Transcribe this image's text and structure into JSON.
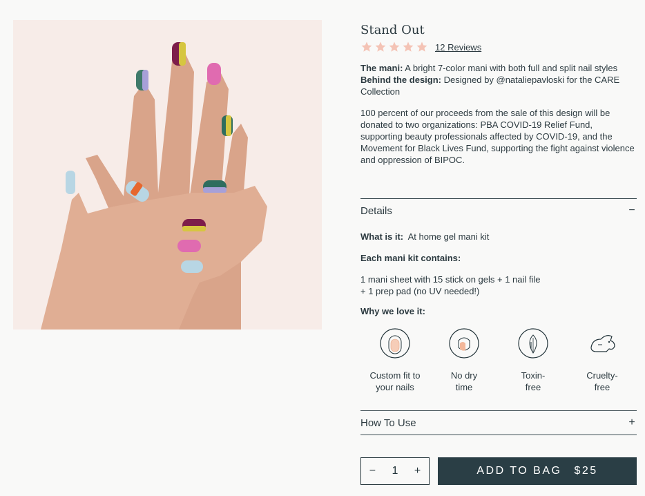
{
  "product": {
    "title": "Stand Out",
    "rating": 5,
    "reviews_label": "12 Reviews",
    "mani_label": "The mani:",
    "mani_text": " A bright 7-color mani with both full and split nail styles",
    "design_label": "Behind the design:",
    "design_text": " Designed by @nataliepavloski for the CARE Collection",
    "proceeds_text": "100 percent of our proceeds from the sale of this design will be donated to two organizations: PBA COVID-19 Relief Fund, supporting beauty professionals affected by COVID-19, and the Movement for Black Lives Fund, supporting the fight against violence and oppression of BIPOC."
  },
  "colors": {
    "star": "#f4c3b5",
    "button": "#2a3e45",
    "background": "#f9f9f8"
  },
  "details": {
    "title": "Details",
    "toggle": "−",
    "what_label": "What is it:",
    "what_text": "  At home gel mani kit",
    "contains_label": "Each mani kit contains:",
    "contains_line1": "1 mani sheet with 15 stick on gels + 1 nail file",
    "contains_line2": "+ 1 prep pad (no UV needed!)",
    "why_label": "Why we love it:",
    "features": [
      {
        "icon": "custom-fit-icon",
        "line1": "Custom fit to",
        "line2": "your nails"
      },
      {
        "icon": "no-dry-time-icon",
        "line1": "No dry",
        "line2": "time"
      },
      {
        "icon": "toxin-free-icon",
        "line1": "Toxin-",
        "line2": "free"
      },
      {
        "icon": "cruelty-free-icon",
        "line1": "Cruelty-",
        "line2": "free"
      }
    ]
  },
  "howto": {
    "title": "How To Use",
    "toggle": "+"
  },
  "cart": {
    "minus": "−",
    "qty": "1",
    "plus": "+",
    "add_label": "ADD TO BAG",
    "price": "$25"
  }
}
